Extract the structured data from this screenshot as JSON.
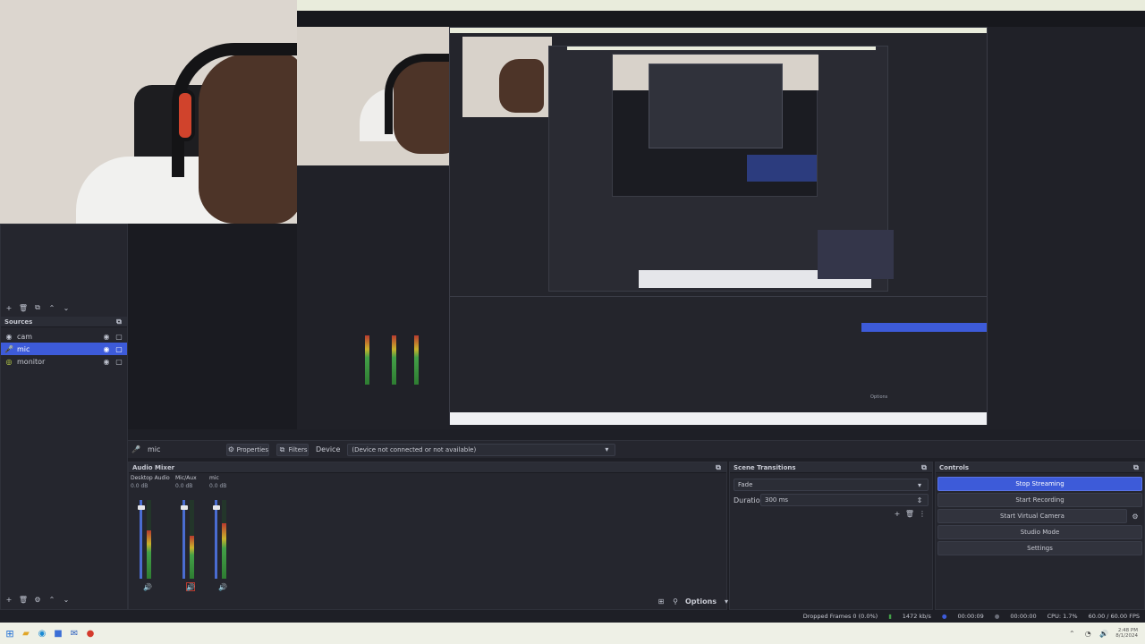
{
  "taskbar": {
    "time": "2:48 PM",
    "date": "8/1/2024"
  },
  "sources": {
    "title": "Sources",
    "items": [
      {
        "label": "cam",
        "selected": false
      },
      {
        "label": "mic",
        "selected": true
      },
      {
        "label": "monitor",
        "selected": false
      }
    ]
  },
  "context_bar": {
    "source_name": "mic",
    "properties_label": "Properties",
    "filters_label": "Filters",
    "device_label": "Device",
    "device_value": "(Device not connected or not available)"
  },
  "audio_mixer": {
    "title": "Audio Mixer",
    "channels": [
      {
        "label": "Desktop Audio",
        "db": "0.0 dB",
        "level": 0.62
      },
      {
        "label": "Mic/Aux",
        "db": "0.0 dB",
        "level": 0.55
      },
      {
        "label": "mic",
        "db": "0.0 dB",
        "level": 0.7
      }
    ]
  },
  "transitions": {
    "title": "Scene Transitions",
    "type": "Fade",
    "duration_label": "Duration",
    "duration_value": "300 ms"
  },
  "controls": {
    "title": "Controls",
    "stop_streaming": "Stop Streaming",
    "start_recording": "Start Recording",
    "start_virtual_camera": "Start Virtual Camera",
    "studio_mode": "Studio Mode",
    "settings": "Settings"
  },
  "status_bar": {
    "dropped_frames": "Dropped Frames 0 (0.0%)",
    "bitrate": "1472 kb/s",
    "stream_time": "00:00:09",
    "rec_time": "00:00:00",
    "cpu": "CPU: 1.7%",
    "fps": "60.00 / 60.00 FPS"
  },
  "footer": {
    "options_label": "Options",
    "nested_options": "Options"
  },
  "colors": {
    "accent": "#3d5bd9",
    "panel": "#25262e",
    "background": "#1e1f26"
  }
}
